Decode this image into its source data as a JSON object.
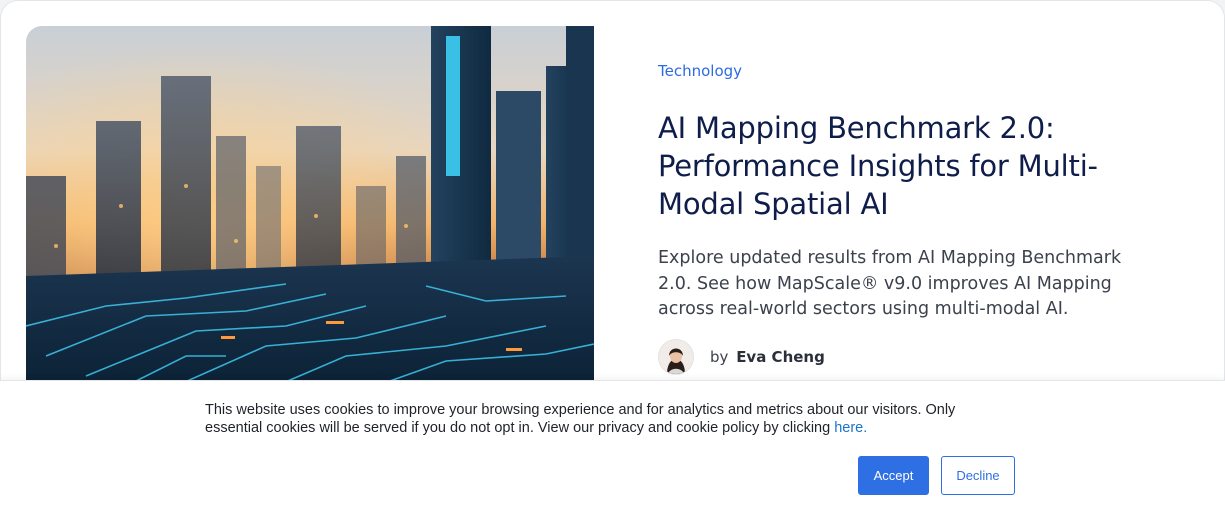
{
  "article": {
    "category": "Technology",
    "title": "AI Mapping Benchmark 2.0: Performance Insights for Multi-Modal Spatial AI",
    "excerpt": "Explore updated results from AI Mapping Benchmark 2.0. See how MapScale® v9.0 improves AI Mapping across real-world sectors using multi-modal AI.",
    "author_prefix": "by",
    "author_name": "Eva Cheng",
    "image_icon": "city-circuit-image"
  },
  "cookie_banner": {
    "text": "This website uses cookies to improve your browsing experience and for analytics and metrics about our visitors. Only essential cookies will be served if you do not opt in. View our privacy and cookie policy by clicking",
    "link_text": "here.",
    "accept_label": "Accept",
    "decline_label": "Decline"
  },
  "colors": {
    "accent": "#2f6fe4",
    "category": "#2d6be0",
    "title": "#0f1d4a",
    "link": "#1b74c9"
  }
}
